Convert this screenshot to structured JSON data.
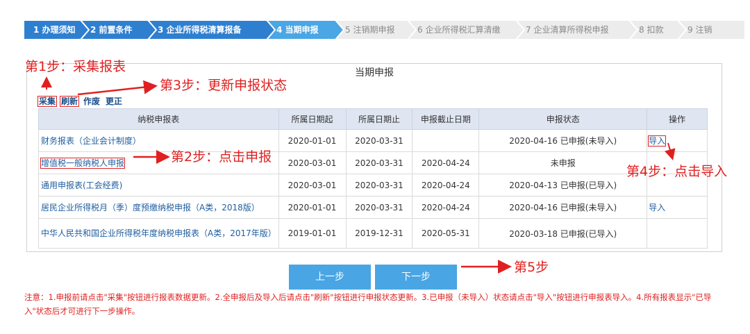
{
  "wizard": {
    "steps": [
      {
        "label": "1 办理须知",
        "state": "done"
      },
      {
        "label": "2 前置条件",
        "state": "done"
      },
      {
        "label": "3 企业所得税清算报备",
        "state": "done"
      },
      {
        "label": "4 当期申报",
        "state": "current"
      },
      {
        "label": "5 注销期申报",
        "state": "todo"
      },
      {
        "label": "6 企业所得税汇算清缴",
        "state": "todo"
      },
      {
        "label": "7 企业清算所得税申报",
        "state": "todo"
      },
      {
        "label": "8 扣款",
        "state": "todo"
      },
      {
        "label": "9 注销",
        "state": "todo"
      }
    ],
    "colors": {
      "done": "#2f7fd0",
      "current": "#4aa6e4",
      "todo": "#ececec"
    }
  },
  "annotations": {
    "step1": "第1步：采集报表",
    "step2": "第2步：点击申报",
    "step3": "第3步：更新申报状态",
    "step4": "第4步：点击导入",
    "step5": "第5步",
    "color": "#e02020"
  },
  "panel": {
    "title": "当期申报",
    "toolbar": {
      "collect": "采集",
      "refresh": "刷新",
      "void": "作废",
      "correct": "更正"
    },
    "table": {
      "headers": [
        "纳税申报表",
        "所属日期起",
        "所属日期止",
        "申报截止日期",
        "申报状态",
        "操作"
      ],
      "rows": [
        {
          "name": "财务报表（企业会计制度）",
          "start": "2020-01-01",
          "end": "2020-03-31",
          "deadline": "",
          "status": "2020-04-16 已申报(未导入)",
          "op": "导入"
        },
        {
          "name": "增值税一般纳税人申报",
          "start": "2020-03-01",
          "end": "2020-03-31",
          "deadline": "2020-04-24",
          "status": "未申报",
          "op": ""
        },
        {
          "name": "通用申报表(工会经费)",
          "start": "2020-03-01",
          "end": "2020-03-31",
          "deadline": "2020-04-24",
          "status": "2020-04-13 已申报(已导入)",
          "op": ""
        },
        {
          "name": "居民企业所得税月（季）度预缴纳税申报（A类，2018版）",
          "start": "2020-01-01",
          "end": "2020-03-31",
          "deadline": "2020-04-24",
          "status": "2020-04-16 已申报(未导入)",
          "op": "导入"
        },
        {
          "name": "中华人民共和国企业所得税年度纳税申报表（A类，2017年版）",
          "start": "2019-01-01",
          "end": "2019-12-31",
          "deadline": "2020-05-31",
          "status": "2020-03-18 已申报(已导入)",
          "op": ""
        }
      ]
    }
  },
  "buttons": {
    "prev": "上一步",
    "next": "下一步"
  },
  "note": "注意：1.申报前请点击\"采集\"按钮进行报表数据更新。2.全申报后及导入后请点击\"刷新\"按钮进行申报状态更新。3.已申报（未导入）状态请点击\"导入\"按钮进行申报表导入。4.所有报表显示\"已导入\"状态后才可进行下一步操作。"
}
